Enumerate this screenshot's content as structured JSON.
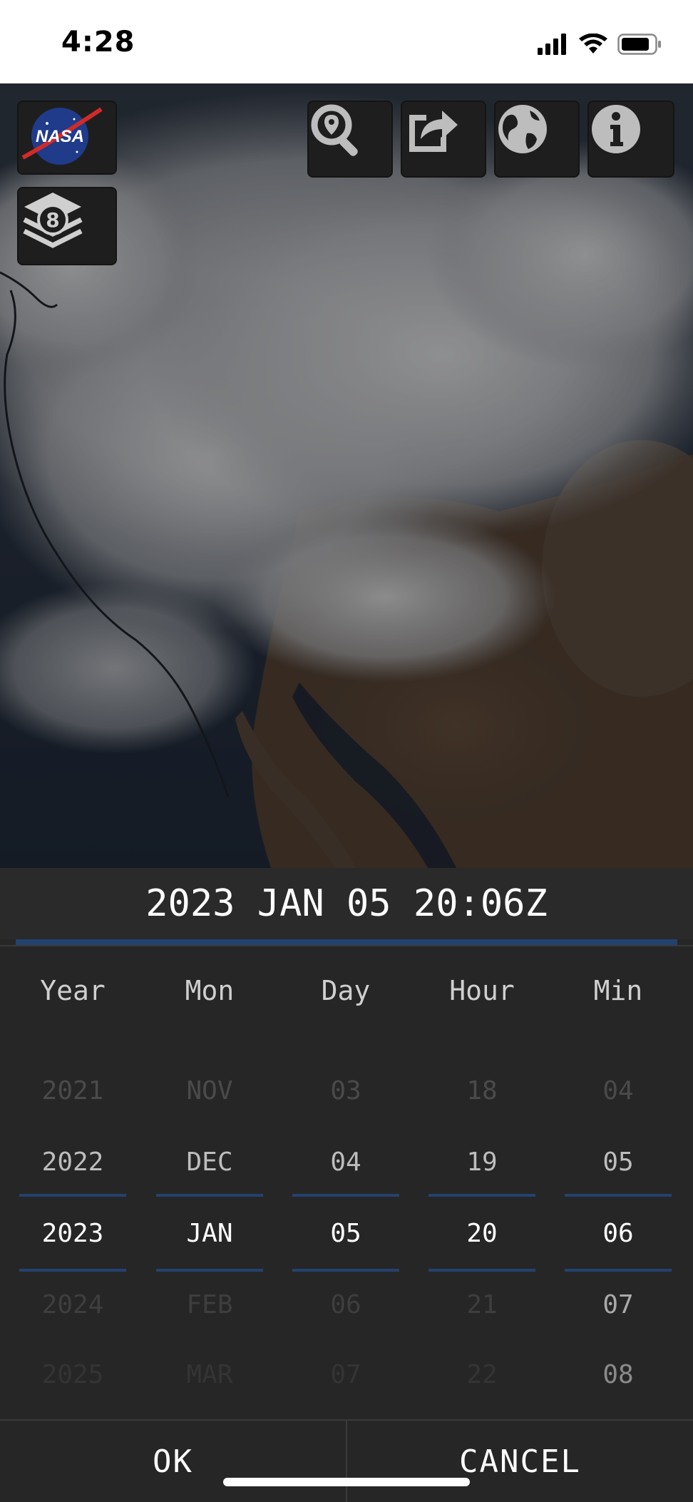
{
  "status_bar": {
    "time": "4:28",
    "icons": [
      "signal-icon",
      "wifi-icon",
      "battery-icon"
    ]
  },
  "map": {
    "description_icon": "satellite-image",
    "toolbar": {
      "nasa_logo_text": "NASA",
      "band_badge_number": "8",
      "icons": [
        "zoom-location-icon",
        "share-icon",
        "globe-icon",
        "info-icon"
      ]
    }
  },
  "date_picker": {
    "display": "2023 JAN 05 20:06Z",
    "headers": [
      "Year",
      "Mon",
      "Day",
      "Hour",
      "Min"
    ],
    "columns": {
      "year": [
        "2021",
        "2022",
        "2023",
        "2024",
        "2025"
      ],
      "mon": [
        "NOV",
        "DEC",
        "JAN",
        "FEB",
        "MAR"
      ],
      "day": [
        "03",
        "04",
        "05",
        "06",
        "07"
      ],
      "hour": [
        "18",
        "19",
        "20",
        "21",
        "22"
      ],
      "min": [
        "04",
        "05",
        "06",
        "07",
        "08"
      ]
    },
    "selected": {
      "year": "2023",
      "mon": "JAN",
      "day": "05",
      "hour": "20",
      "min": "06"
    }
  },
  "actions": {
    "ok_label": "OK",
    "cancel_label": "CANCEL"
  },
  "colors": {
    "accent": "#24426f",
    "panel_bg": "#262626"
  }
}
